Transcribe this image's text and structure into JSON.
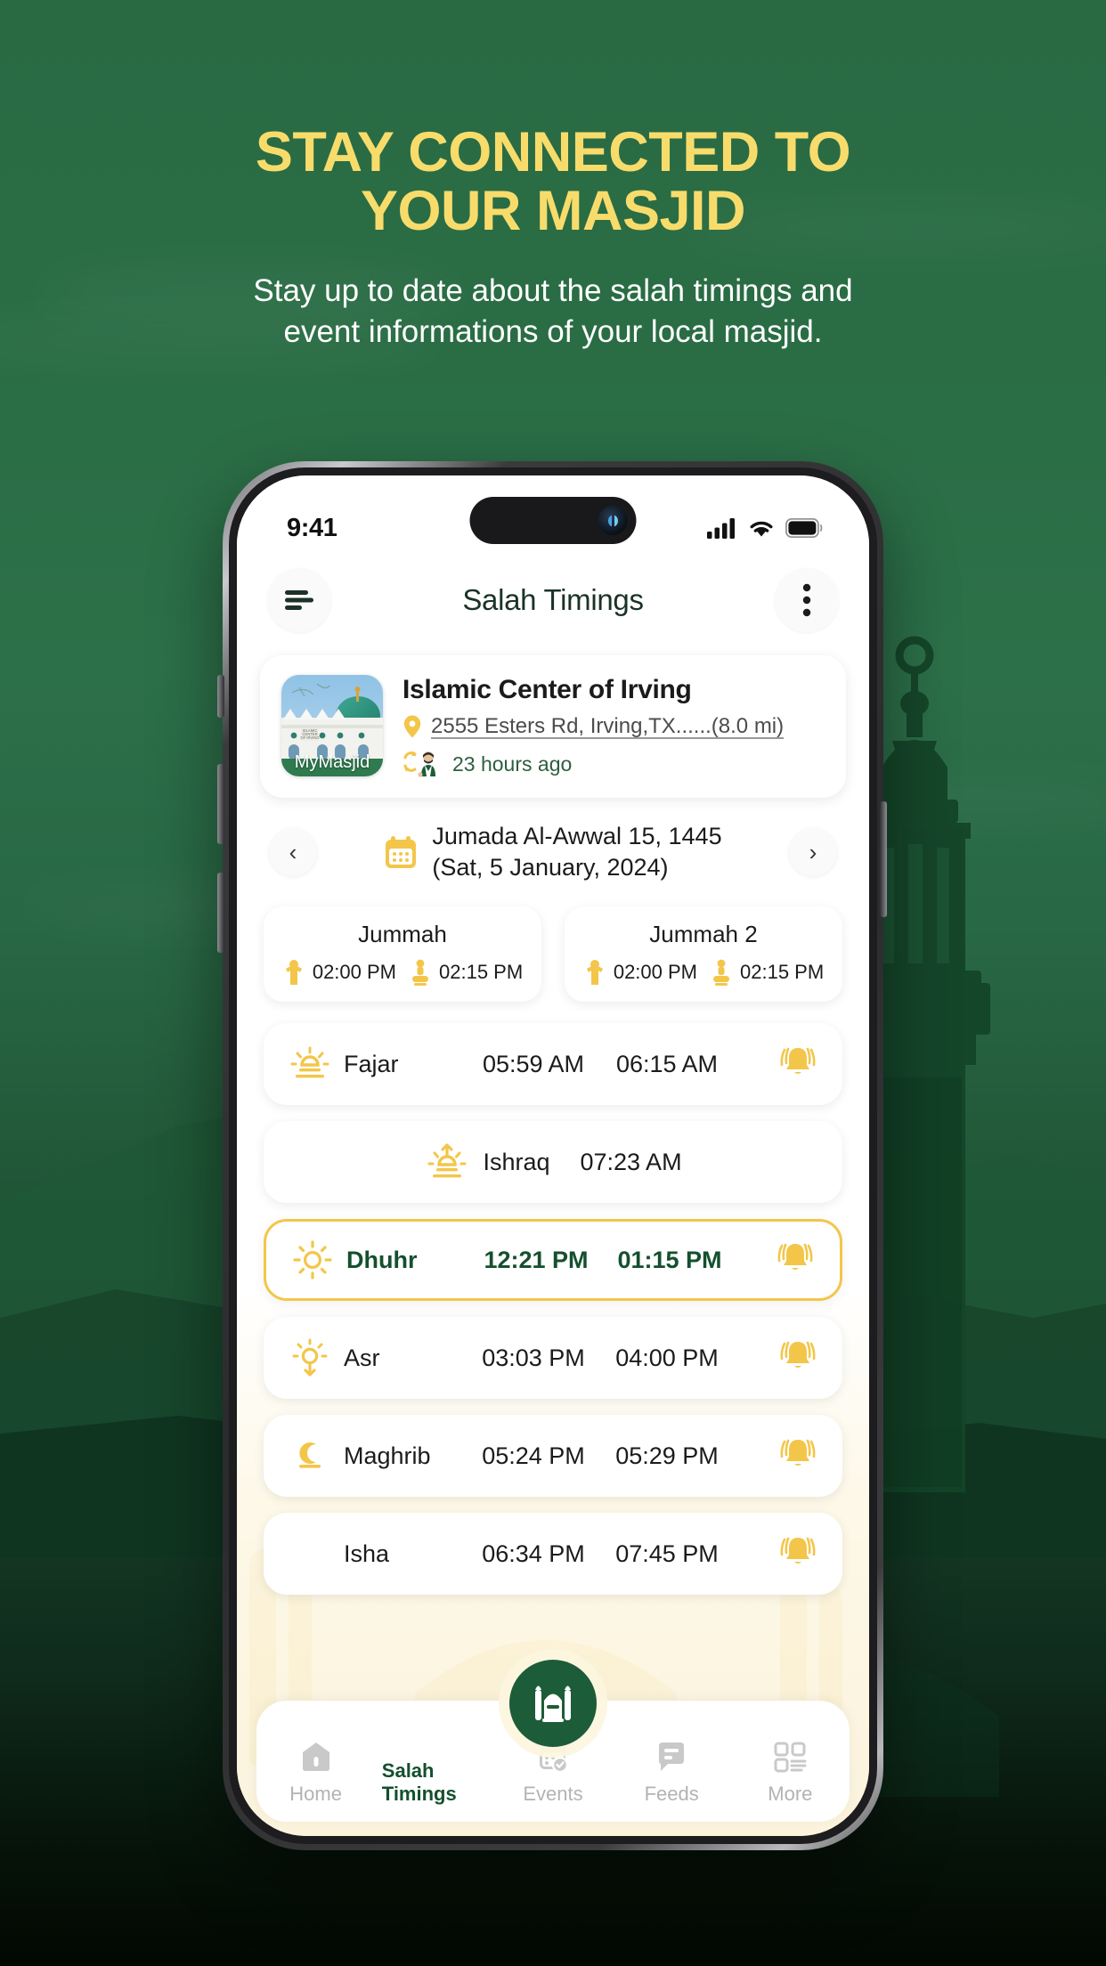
{
  "promo": {
    "headline_line1": "STAY CONNECTED TO",
    "headline_line2": "YOUR MASJID",
    "subtitle_line1": "Stay up to date about the salah timings and",
    "subtitle_line2": "event informations of your local masjid."
  },
  "colors": {
    "brand_green": "#1d5c38",
    "dark_green": "#14502e",
    "accent_yellow": "#F3C64A",
    "headline_yellow": "#F8DC6B",
    "bg_green": "#296a43"
  },
  "statusbar": {
    "time": "9:41",
    "icons": [
      "cellular-signal-icon",
      "wifi-icon",
      "battery-icon"
    ]
  },
  "appheader": {
    "menu_icon": "hamburger-menu-icon",
    "title": "Salah Timings",
    "more_icon": "more-vertical-icon"
  },
  "masjid": {
    "thumb_label": "MyMasjid",
    "name": "Islamic Center of Irving",
    "address": "2555 Esters Rd, Irving,TX......(8.0 mi)",
    "location_icon": "map-pin-icon",
    "updated_icon": "sync-person-icon",
    "updated": "23 hours ago"
  },
  "datenav": {
    "prev_icon": "chevron-left-icon",
    "next_icon": "chevron-right-icon",
    "calendar_icon": "calendar-icon",
    "hijri": "Jumada Al-Awwal 15, 1445",
    "gregorian": "(Sat, 5 January, 2024)"
  },
  "jummah": [
    {
      "title": "Jummah",
      "khutbah_icon": "khutbah-icon",
      "khutbah_time": "02:00 PM",
      "jamaat_icon": "jamaat-icon",
      "jamaat_time": "02:15 PM"
    },
    {
      "title": "Jummah 2",
      "khutbah_icon": "khutbah-icon",
      "khutbah_time": "02:00 PM",
      "jamaat_icon": "jamaat-icon",
      "jamaat_time": "02:15 PM"
    }
  ],
  "prayers": [
    {
      "name": "Fajar",
      "icon": "sunrise-icon",
      "begin": "05:59 AM",
      "jamaat": "06:15 AM",
      "bell": true,
      "active": false,
      "centered": false
    },
    {
      "name": "Ishraq",
      "icon": "ishraq-icon",
      "begin": "07:23 AM",
      "jamaat": "",
      "bell": false,
      "active": false,
      "centered": true
    },
    {
      "name": "Dhuhr",
      "icon": "sun-icon",
      "begin": "12:21 PM",
      "jamaat": "01:15 PM",
      "bell": true,
      "active": true,
      "centered": false
    },
    {
      "name": "Asr",
      "icon": "sunset-icon",
      "begin": "03:03 PM",
      "jamaat": "04:00 PM",
      "bell": true,
      "active": false,
      "centered": false
    },
    {
      "name": "Maghrib",
      "icon": "moonset-icon",
      "begin": "05:24 PM",
      "jamaat": "05:29 PM",
      "bell": true,
      "active": false,
      "centered": false
    },
    {
      "name": "Isha",
      "icon": "moon-icon",
      "begin": "06:34 PM",
      "jamaat": "07:45 PM",
      "bell": true,
      "active": false,
      "centered": false
    }
  ],
  "bottomnav": {
    "fab_icon": "mosque-icon",
    "items": [
      {
        "label": "Home",
        "icon": "home-icon",
        "active": false
      },
      {
        "label": "Salah Timings",
        "icon": "mosque-icon",
        "active": true
      },
      {
        "label": "Events",
        "icon": "events-icon",
        "active": false
      },
      {
        "label": "Feeds",
        "icon": "feeds-icon",
        "active": false
      },
      {
        "label": "More",
        "icon": "grid-more-icon",
        "active": false
      }
    ]
  }
}
